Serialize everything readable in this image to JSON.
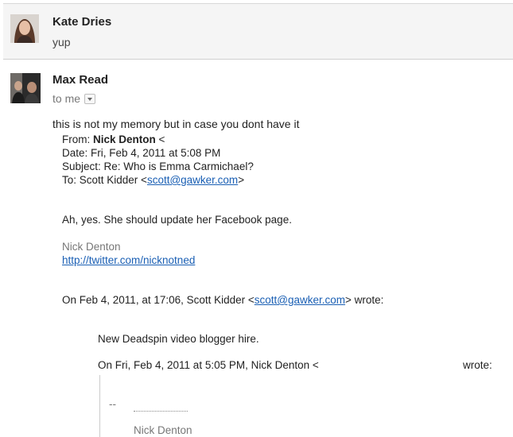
{
  "messages": [
    {
      "sender": "Kate Dries",
      "snippet": "yup"
    },
    {
      "sender": "Max Read",
      "recipient_label": "to me",
      "body_intro": "this is not my memory but in case you dont have it",
      "forwarded": {
        "from_label": "From: ",
        "from_name": "Nick Denton",
        "from_tail": " <",
        "date": "Date: Fri, Feb 4, 2011 at 5:08 PM",
        "subject": "Subject: Re: Who is Emma Carmichael?",
        "to_label": "To: Scott Kidder <",
        "to_email": "scott@gawker.com",
        "to_close": ">",
        "reply": "Ah, yes. She should update her Facebook page.",
        "signature_name": "Nick Denton",
        "signature_link": "http://twitter.com/nicknotned",
        "quote1_prefix": "On Feb 4, 2011, at 17:06, Scott Kidder <",
        "quote1_email": "scott@gawker.com",
        "quote1_suffix": "> wrote:",
        "quote1_body": "New Deadspin video blogger hire.",
        "quote2_prefix": "On Fri, Feb 4, 2011 at 5:05 PM, Nick Denton <",
        "quote2_suffix": "wrote:",
        "quote2_dashes": "--",
        "quote2_signature": "Nick Denton"
      }
    }
  ]
}
